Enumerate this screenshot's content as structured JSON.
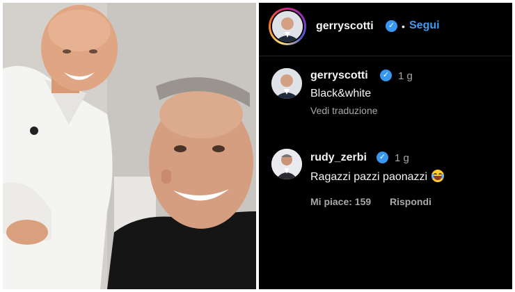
{
  "post": {
    "author": "gerryscotti",
    "follow_label": "Segui",
    "separator": "•"
  },
  "comments": [
    {
      "username": "gerryscotti",
      "time": "1 g",
      "text": "Black&white",
      "translate_label": "Vedi traduzione"
    },
    {
      "username": "rudy_zerbi",
      "time": "1 g",
      "text": "Ragazzi pazzi paonazzi",
      "likes_label": "Mi piace: 159",
      "reply_label": "Rispondi"
    }
  ],
  "icons": {
    "verified": "verified-badge-icon",
    "emoji": "grinning-tears-emoji"
  },
  "colors": {
    "background": "#000000",
    "follow": "#3d9bf5",
    "verified": "#3897f0",
    "muted_text": "#a8a8a8"
  }
}
